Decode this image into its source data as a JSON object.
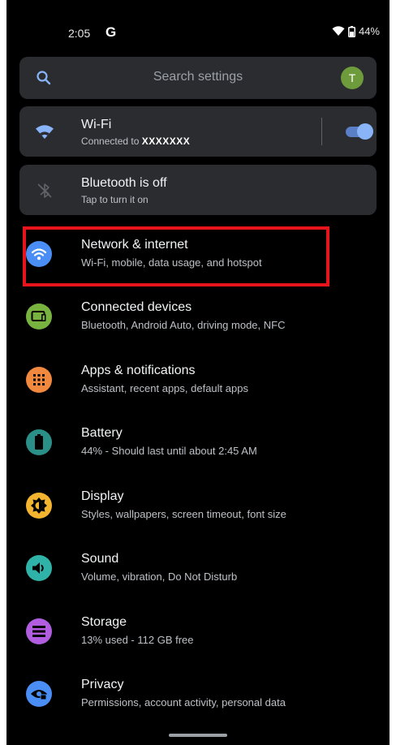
{
  "status_bar": {
    "time": "2:05",
    "g_logo": "G",
    "battery": "44%",
    "icons": [
      "wifi-icon",
      "battery-icon"
    ]
  },
  "search": {
    "placeholder": "Search settings",
    "avatar_letter": "T",
    "avatar_color": "#6e9b3c"
  },
  "suggestions": {
    "wifi": {
      "title": "Wi-Fi",
      "subtitle_prefix": "Connected to",
      "network_name": "XXXXXXX",
      "toggle_on": true,
      "icon": "wifi-icon"
    },
    "bluetooth": {
      "title": "Bluetooth is off",
      "subtitle": "Tap to turn it on",
      "icon": "bluetooth-off-icon"
    }
  },
  "items": [
    {
      "title": "Network & internet",
      "subtitle": "Wi-Fi, mobile, data usage, and hotspot",
      "icon": "wifi-icon",
      "color": "#4a8ef5",
      "highlighted": true
    },
    {
      "title": "Connected devices",
      "subtitle": "Bluetooth, Android Auto, driving mode, NFC",
      "icon": "devices-icon",
      "color": "#79b33f"
    },
    {
      "title": "Apps & notifications",
      "subtitle": "Assistant, recent apps, default apps",
      "icon": "apps-grid-icon",
      "color": "#f0883e"
    },
    {
      "title": "Battery",
      "subtitle": "44% - Should last until about 2:45 AM",
      "icon": "battery-icon",
      "color": "#2a8f87"
    },
    {
      "title": "Display",
      "subtitle": "Styles, wallpapers, screen timeout, font size",
      "icon": "brightness-icon",
      "color": "#f3b42f"
    },
    {
      "title": "Sound",
      "subtitle": "Volume, vibration, Do Not Disturb",
      "icon": "speaker-icon",
      "color": "#2fb3a9"
    },
    {
      "title": "Storage",
      "subtitle": "13% used - 112 GB free",
      "icon": "storage-icon",
      "color": "#b15de0"
    },
    {
      "title": "Privacy",
      "subtitle": "Permissions, account activity, personal data",
      "icon": "privacy-icon",
      "color": "#4a8ef5"
    }
  ],
  "colors": {
    "background": "#000000",
    "card": "#2b2c30",
    "highlight": "#e8141b",
    "toggle_accent": "#8ab4f8"
  }
}
